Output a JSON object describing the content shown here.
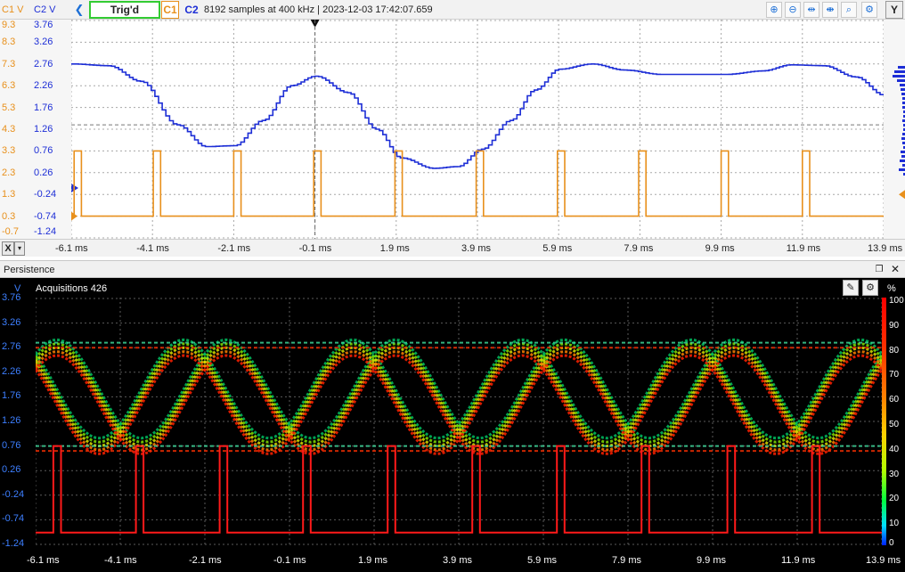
{
  "toolbar": {
    "c1_axis_unit": "C1 V",
    "c2_axis_unit": "C2 V",
    "back_glyph": "❮",
    "trigger_status": "Trig'd",
    "c1_button": "C1",
    "c2_button": "C2",
    "sample_info": "8192 samples at 400 kHz | 2023-12-03 17:42:07.659",
    "icons": [
      "zoom-in-icon",
      "zoom-out-icon",
      "horizontal-zoom-icon",
      "horizontal-zoom-out-icon",
      "vertical-zoom-icon",
      "zoom-fit-icon",
      "settings-icon"
    ],
    "y_button": "Y"
  },
  "upper": {
    "c1_ticks": [
      "9.3",
      "8.3",
      "7.3",
      "6.3",
      "5.3",
      "4.3",
      "3.3",
      "2.3",
      "1.3",
      "0.3",
      "-0.7"
    ],
    "c2_ticks": [
      "3.76",
      "3.26",
      "2.76",
      "2.26",
      "1.76",
      "1.26",
      "0.76",
      "0.26",
      "-0.24",
      "-0.74",
      "-1.24"
    ],
    "x_button": "X",
    "x_dropdown": "▾",
    "x_ticks": [
      "-6.1 ms",
      "-4.1 ms",
      "-2.1 ms",
      "-0.1 ms",
      "1.9 ms",
      "3.9 ms",
      "5.9 ms",
      "7.9 ms",
      "9.9 ms",
      "11.9 ms",
      "13.9 ms"
    ]
  },
  "persistence": {
    "title": "Persistence",
    "unit": "V",
    "acquisitions": "Acquisitions 426",
    "percent_unit": "%",
    "y_ticks": [
      "3.76",
      "3.26",
      "2.76",
      "2.26",
      "1.76",
      "1.26",
      "0.76",
      "0.26",
      "-0.24",
      "-0.74",
      "-1.24"
    ],
    "pct_ticks": [
      "100",
      "90",
      "80",
      "70",
      "60",
      "50",
      "40",
      "30",
      "20",
      "10",
      "0"
    ],
    "x_ticks": [
      "-6.1 ms",
      "-4.1 ms",
      "-2.1 ms",
      "-0.1 ms",
      "1.9 ms",
      "3.9 ms",
      "5.9 ms",
      "7.9 ms",
      "9.9 ms",
      "11.9 ms",
      "13.9 ms"
    ]
  },
  "colors": {
    "c1": "#e8901c",
    "c2": "#1d2ed6",
    "trigger_border": "#33cc33",
    "persistence_bg": "#000000"
  },
  "chart_data": [
    {
      "type": "line",
      "series": [
        {
          "name": "C2",
          "x": [
            -6.1,
            -5.2,
            -4.4,
            -3.5,
            -2.8,
            -2.1,
            -1.4,
            -0.7,
            -0.1,
            0.7,
            1.4,
            2.0,
            2.8,
            3.4,
            4.0,
            4.7,
            5.3,
            5.9,
            6.7,
            7.5,
            8.4,
            9.1,
            10.0,
            10.9,
            11.6,
            12.4,
            13.2,
            13.9
          ],
          "y": [
            2.76,
            2.72,
            2.36,
            1.36,
            0.86,
            0.88,
            1.46,
            2.26,
            2.48,
            2.1,
            1.26,
            0.6,
            0.36,
            0.4,
            0.8,
            1.46,
            2.16,
            2.64,
            2.76,
            2.62,
            2.52,
            2.52,
            2.52,
            2.6,
            2.74,
            2.72,
            2.46,
            2.04
          ]
        },
        {
          "name": "C1",
          "pulse_starts": [
            -6.03,
            -4.08,
            -2.1,
            -0.13,
            1.87,
            3.87,
            5.87,
            7.87,
            9.9,
            11.9
          ],
          "pulse_width_ms": 0.18,
          "high": 3.3,
          "low": 0.3
        }
      ],
      "xlim": [
        -6.1,
        13.9
      ],
      "c1_ylim": [
        -0.7,
        9.3
      ],
      "c2_ylim": [
        -1.24,
        3.76
      ]
    },
    {
      "type": "line",
      "xlim": [
        -6.1,
        13.9
      ],
      "ylim": [
        -1.24,
        3.76
      ],
      "eye_period_ms": 2.0,
      "upper_rail": 2.76,
      "lower_rail": 0.76,
      "pulse_high": 0.76,
      "pulse_low": -1.0,
      "colorbar_range": [
        0,
        100
      ]
    }
  ]
}
